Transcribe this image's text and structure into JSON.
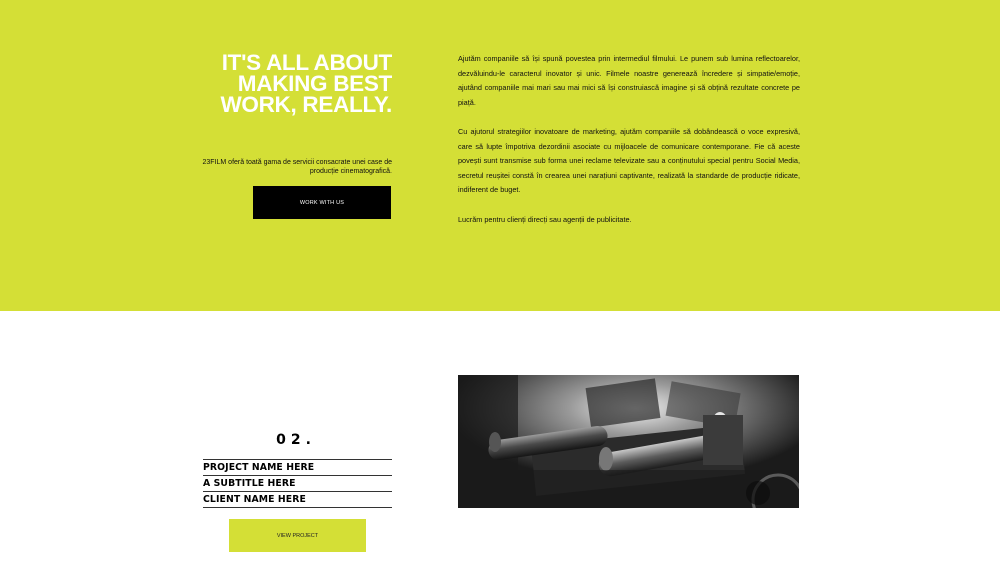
{
  "hero": {
    "headline": [
      "IT'S ALL ABOUT",
      "MAKING BEST",
      "WORK, REALLY."
    ],
    "tagline": "23FILM oferă toată gama de servicii consacrate unei case de producție cinematografică.",
    "cta_label": "WORK WITH US",
    "background_color": "#d4df36",
    "paragraphs": [
      "Ajutăm companiile să își spună povestea prin intermediul filmului. Le punem sub lumina reflectoarelor, dezvăluindu-le caracterul inovator și unic. Filmele noastre generează încredere și simpatie/emoție, ajutând companiile mai mari sau mai mici să își construiască imagine și să obțină rezultate concrete pe piață.",
      "Cu ajutorul strategiilor inovatoare de marketing, ajutăm companiile să dobândească o voce expresivă, care să lupte împotriva dezordinii asociate cu mijloacele de comunicare contemporane. Fie că aceste povești sunt transmise sub forma unei reclame televizate sau a conținutului special pentru Social Media, secretul reușitei constă în crearea unei narațiuni captivante, realizată la standarde de producție ridicate, indiferent de buget.",
      "Lucrăm pentru clienți direcți sau agenții de publicitate."
    ]
  },
  "project": {
    "number": "02.",
    "name": "PROJECT NAME HERE",
    "subtitle": "A SUBTITLE HERE",
    "client": "CLIENT NAME HERE",
    "cta_label": "VIEW PROJECT",
    "image_icon": "camera-rig-photo"
  }
}
